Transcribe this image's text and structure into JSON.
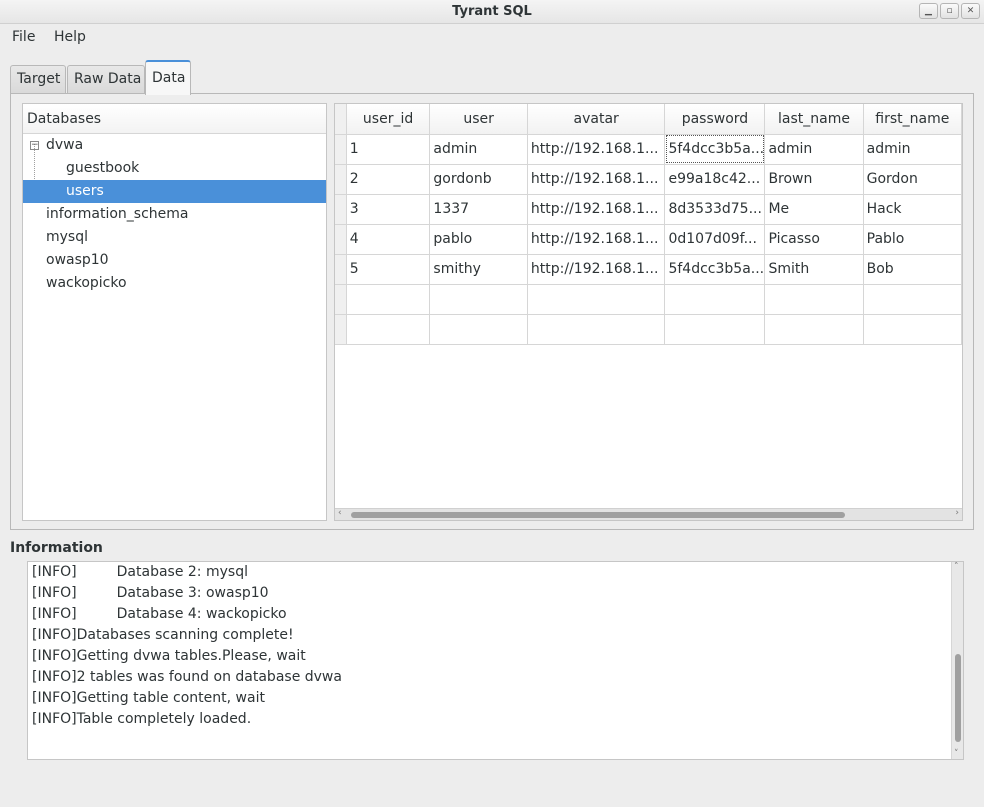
{
  "window": {
    "title": "Tyrant SQL"
  },
  "menu": {
    "file": "File",
    "help": "Help"
  },
  "tabs": [
    {
      "label": "Target",
      "active": false
    },
    {
      "label": "Raw Data",
      "active": false
    },
    {
      "label": "Data",
      "active": true
    }
  ],
  "databases": {
    "header": "Databases",
    "items": [
      {
        "label": "dvwa",
        "expander": "−",
        "expanded": true
      },
      {
        "label": "guestbook",
        "child": true
      },
      {
        "label": "users",
        "child": true,
        "selected": true
      },
      {
        "label": "information_schema"
      },
      {
        "label": "mysql"
      },
      {
        "label": "owasp10"
      },
      {
        "label": "wackopicko"
      }
    ]
  },
  "table": {
    "columns": [
      "user_id",
      "user",
      "avatar",
      "password",
      "last_name",
      "first_name"
    ],
    "rows": [
      [
        "1",
        "admin",
        "http://192.168.1...",
        "5f4dcc3b5a...",
        "admin",
        "admin"
      ],
      [
        "2",
        "gordonb",
        "http://192.168.1...",
        "e99a18c42...",
        "Brown",
        "Gordon"
      ],
      [
        "3",
        "1337",
        "http://192.168.1...",
        "8d3533d75...",
        "Me",
        "Hack"
      ],
      [
        "4",
        "pablo",
        "http://192.168.1...",
        "0d107d09f...",
        "Picasso",
        "Pablo"
      ],
      [
        "5",
        "smithy",
        "http://192.168.1...",
        "5f4dcc3b5a...",
        "Smith",
        "Bob"
      ],
      [
        "",
        "",
        "",
        "",
        "",
        ""
      ],
      [
        "",
        "",
        "",
        "",
        "",
        ""
      ]
    ]
  },
  "information": {
    "label": "Information",
    "lines": [
      "[INFO]         Database 2: mysql",
      "[INFO]         Database 3: owasp10",
      "[INFO]         Database 4: wackopicko",
      "[INFO]Databases scanning complete!",
      "[INFO]Getting dvwa tables.Please, wait",
      "[INFO]2 tables was found on database dvwa",
      "[INFO]Getting table content, wait",
      "[INFO]Table completely loaded."
    ]
  }
}
